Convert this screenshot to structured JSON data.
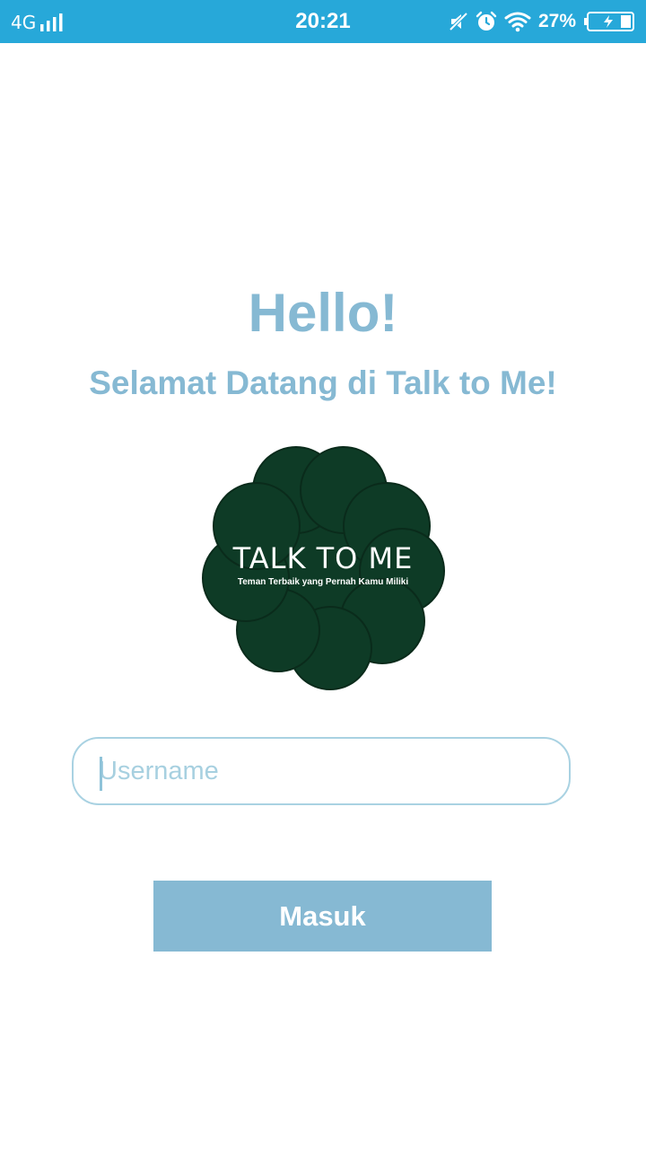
{
  "status_bar": {
    "network_type": "4G",
    "time": "20:21",
    "battery_percent": "27%",
    "background_color": "#27a8d9",
    "icons": [
      "signal-icon",
      "mute-icon",
      "alarm-icon",
      "wifi-icon",
      "battery-charging-icon"
    ]
  },
  "welcome": {
    "title": "Hello!",
    "subtitle": "Selamat Datang di Talk to Me!",
    "text_color": "#86b9d3"
  },
  "logo": {
    "title": "TALK TO ME",
    "tagline": "Teman Terbaik yang Pernah Kamu Miliki",
    "color": "#0e3b26"
  },
  "login_form": {
    "username_placeholder": "Username",
    "username_value": "",
    "submit_label": "Masuk",
    "button_color": "#86b9d3"
  }
}
